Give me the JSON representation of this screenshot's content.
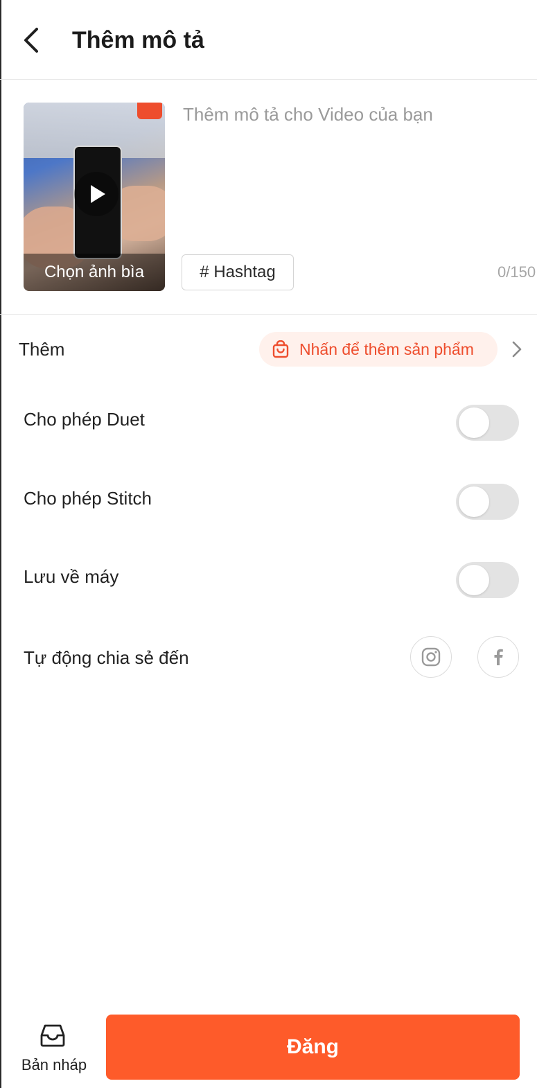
{
  "header": {
    "back_icon": "chevron-left-icon",
    "title": "Thêm mô tả"
  },
  "media": {
    "cover_label": "Chọn ảnh bìa",
    "description_placeholder": "Thêm mô tả cho Video của bạn",
    "description_value": "",
    "hashtag_label": "# Hashtag",
    "char_count": "0/150"
  },
  "add_product": {
    "label": "Thêm",
    "chip_label": "Nhấn để thêm sản phẩm",
    "chip_icon": "shopping-bag-icon"
  },
  "settings": {
    "allow_duet": {
      "label": "Cho phép Duet",
      "enabled": false
    },
    "allow_stitch": {
      "label": "Cho phép Stitch",
      "enabled": false
    },
    "save_to_device": {
      "label": "Lưu về máy",
      "enabled": false
    },
    "auto_share": {
      "label": "Tự động chia sẻ đến",
      "targets": [
        "instagram-icon",
        "facebook-icon"
      ]
    }
  },
  "footer": {
    "draft_label": "Bản nháp",
    "draft_icon": "inbox-tray-icon",
    "post_label": "Đăng"
  },
  "colors": {
    "accent": "#ee4d2d",
    "post_button": "#fe5b2a",
    "chip_background": "#fff1ec",
    "toggle_off": "#e3e3e3"
  }
}
